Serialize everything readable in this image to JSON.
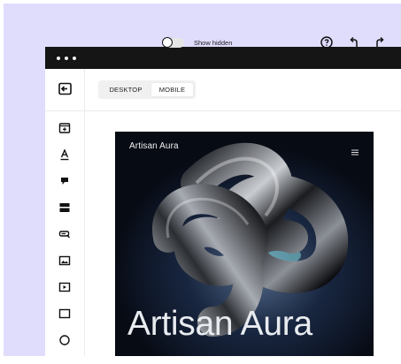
{
  "toolbar": {
    "collapse_icon": "panel-collapse-icon",
    "view_modes": [
      "DESKTOP",
      "MOBILE"
    ],
    "selected_view_mode": "MOBILE",
    "show_hidden_label": "Show hidden",
    "show_hidden_on": false,
    "help_icon": "help-circle-icon",
    "undo_icon": "undo-icon",
    "redo_icon": "redo-icon"
  },
  "sidebar": {
    "items": [
      {
        "icon": "section-add-icon"
      },
      {
        "icon": "text-icon"
      },
      {
        "icon": "paragraph-icon"
      },
      {
        "icon": "accordion-icon"
      },
      {
        "icon": "button-icon"
      },
      {
        "icon": "image-icon"
      },
      {
        "icon": "video-icon"
      },
      {
        "icon": "rectangle-icon"
      },
      {
        "icon": "circle-icon"
      }
    ]
  },
  "preview": {
    "brand": "Artisan Aura",
    "menu_icon": "hamburger-menu-icon",
    "hero_title": "Artisan Aura"
  },
  "colors": {
    "background": "#e0dcfc",
    "titlebar": "#151515",
    "hero_bg": "#070b14"
  }
}
